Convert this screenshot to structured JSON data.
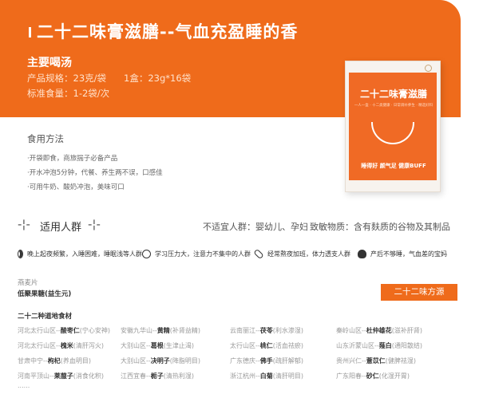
{
  "banner": {
    "title": "二十二味膏滋膳--气血充盈睡的香",
    "subtitle": "主要喝汤",
    "spec_label": "产品规格：23克/袋",
    "spec_box": "1盒：23g*16袋",
    "dose": "标准食量：1-2袋/次",
    "color": "#ef6b1b"
  },
  "product_box": {
    "title": "二十二味膏滋膳",
    "sub": "一人一盒 · 十二类健康 · 日常调补养生 · 精选好料",
    "slogan": "睡得好 颜气足 健康BUFF"
  },
  "usage": {
    "heading": "食用方法",
    "items": [
      "·开袋即食，商旅揣子必备产品",
      "·开水冲泡5分钟，代餐、养生两不误，口感佳",
      "·可用牛奶、酸奶冲泡，美味可口"
    ]
  },
  "people": {
    "deco_left": "-¦-",
    "label": "适用人群",
    "deco_right": "-¦-",
    "unfit": "不适宜人群：婴幼儿、孕妇",
    "allergen": "致敏物质：含有麸质的谷物及其制品"
  },
  "audiences": [
    {
      "icon": "moon-icon",
      "text": "晚上起夜频繁，入睡困难，睡眠浅等人群"
    },
    {
      "icon": "brain-icon",
      "text": "学习压力大，注意力不集中的人群"
    },
    {
      "icon": "pill-icon",
      "text": "经常熬夜加班，体力透支人群"
    },
    {
      "icon": "woman-icon",
      "text": "产后不够睡，气血差的宝妈"
    }
  ],
  "ingredients": {
    "label": "燕麦片",
    "main": "低聚果糖(益生元)"
  },
  "origin_button": "二十二味方源",
  "herbs": {
    "title": "二十二种道地食材",
    "items": [
      {
        "region": "河北太行山区--",
        "name": "酸枣仁",
        "note": "(宁心安神)"
      },
      {
        "region": "安徽九华山--",
        "name": "黄精",
        "note": "(补肾益精)"
      },
      {
        "region": "云南丽江--",
        "name": "茯苓",
        "note": "(利水渗湿)"
      },
      {
        "region": "秦岭山区--",
        "name": "杜仲雄花",
        "note": "(滋补肝肾)"
      },
      {
        "region": "河北太行山区--",
        "name": "槐米",
        "note": "(清肝泻火)"
      },
      {
        "region": "大别山区--",
        "name": "葛根",
        "note": "(生津止渴)"
      },
      {
        "region": "太行山区--",
        "name": "桃仁",
        "note": "(活血祛瘀)"
      },
      {
        "region": "山东沂蒙山区--",
        "name": "薤白",
        "note": "(通阳散结)"
      },
      {
        "region": "甘肃中宁--",
        "name": "枸杞",
        "note": "(养血明目)"
      },
      {
        "region": "大别山区--",
        "name": "决明子",
        "note": "(降脂明目)"
      },
      {
        "region": "广东德庆--",
        "name": "佛手",
        "note": "(疏肝解郁)"
      },
      {
        "region": "贵州兴仁--",
        "name": "薏苡仁",
        "note": "(健脾祛湿)"
      },
      {
        "region": "河南平顶山--",
        "name": "莱菔子",
        "note": "(消食化积)"
      },
      {
        "region": "江西宜春--",
        "name": "栀子",
        "note": "(清热利湿)"
      },
      {
        "region": "浙江杭州--",
        "name": "白菊",
        "note": "(清肝明目)"
      },
      {
        "region": "广东阳春--",
        "name": "砂仁",
        "note": "(化湿开胃)"
      }
    ],
    "more": "......"
  }
}
